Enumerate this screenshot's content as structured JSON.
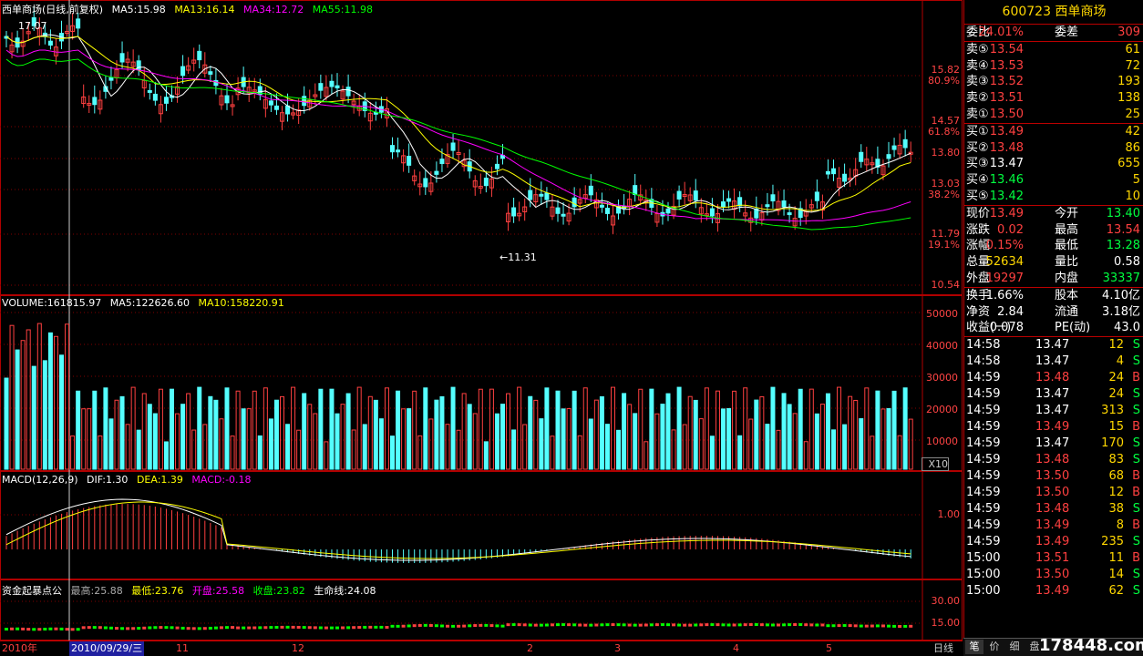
{
  "price_header": {
    "name": "西单商场(日线,前复权)",
    "ma5": "MA5:15.98",
    "ma13": "MA13:16.14",
    "ma34": "MA34:12.72",
    "ma55": "MA55:11.98"
  },
  "price_axis": [
    "15.82",
    "80.9%",
    "14.57",
    "61.8%",
    "13.80",
    "13.03",
    "38.2%",
    "11.79",
    "19.1%",
    "10.54"
  ],
  "price_annotations": {
    "high": "17.07",
    "low": "←11.31"
  },
  "volume_header": {
    "volume": "VOLUME:161815.97",
    "ma5": "MA5:122626.60",
    "ma10": "MA10:158220.91"
  },
  "volume_axis": [
    "50000",
    "40000",
    "30000",
    "20000",
    "10000",
    "X10"
  ],
  "macd_header": {
    "name": "MACD(12,26,9)",
    "dif": "DIF:1.30",
    "dea": "DEA:1.39",
    "macd": "MACD:-0.18"
  },
  "macd_axis": [
    "1.00"
  ],
  "fund_header": {
    "name": "资金起暴点公",
    "high": "最高:25.88",
    "low": "最低:23.76",
    "open": "开盘:25.58",
    "close": "收盘:23.82",
    "life": "生命线:24.08"
  },
  "fund_axis": [
    "30.00",
    "15.00"
  ],
  "date_axis": {
    "year": "2010年",
    "cursor_date": "2010/09/29/三",
    "months": [
      "11",
      "12",
      "2",
      "3",
      "4",
      "5"
    ],
    "period": "日线"
  },
  "quote": {
    "title": "600723 西单商场",
    "ratio": {
      "label": "委比",
      "value": "24.01%",
      "label2": "委差",
      "value2": "309"
    },
    "sells": [
      {
        "label": "卖⑤",
        "price": "13.54",
        "vol": "61"
      },
      {
        "label": "卖④",
        "price": "13.53",
        "vol": "72"
      },
      {
        "label": "卖③",
        "price": "13.52",
        "vol": "193"
      },
      {
        "label": "卖②",
        "price": "13.51",
        "vol": "138"
      },
      {
        "label": "卖①",
        "price": "13.50",
        "vol": "25"
      }
    ],
    "buys": [
      {
        "label": "买①",
        "price": "13.49",
        "vol": "42"
      },
      {
        "label": "买②",
        "price": "13.48",
        "vol": "86"
      },
      {
        "label": "买③",
        "price": "13.47",
        "vol": "655"
      },
      {
        "label": "买④",
        "price": "13.46",
        "vol": "5"
      },
      {
        "label": "买⑤",
        "price": "13.42",
        "vol": "10"
      }
    ],
    "stats": [
      {
        "l1": "现价",
        "v1": "13.49",
        "l2": "今开",
        "v2": "13.40"
      },
      {
        "l1": "涨跌",
        "v1": "0.02",
        "l2": "最高",
        "v2": "13.54"
      },
      {
        "l1": "涨幅",
        "v1": "0.15%",
        "l2": "最低",
        "v2": "13.28"
      },
      {
        "l1": "总量",
        "v1": "52634",
        "l2": "量比",
        "v2": "0.58"
      },
      {
        "l1": "外盘",
        "v1": "19297",
        "l2": "内盘",
        "v2": "33337"
      }
    ],
    "info": [
      {
        "l1": "换手",
        "v1": "1.66%",
        "l2": "股本",
        "v2": "4.10亿"
      },
      {
        "l1": "净资",
        "v1": "2.84",
        "l2": "流通",
        "v2": "3.18亿"
      },
      {
        "l1": "收益(一)",
        "v1": "0.078",
        "l2": "PE(动)",
        "v2": "43.0"
      }
    ],
    "ticks": [
      {
        "t": "14:58",
        "p": "13.47",
        "v": "12",
        "s": "S"
      },
      {
        "t": "14:58",
        "p": "13.47",
        "v": "4",
        "s": "S"
      },
      {
        "t": "14:59",
        "p": "13.48",
        "v": "24",
        "s": "B"
      },
      {
        "t": "14:59",
        "p": "13.47",
        "v": "24",
        "s": "S"
      },
      {
        "t": "14:59",
        "p": "13.47",
        "v": "313",
        "s": "S"
      },
      {
        "t": "14:59",
        "p": "13.49",
        "v": "15",
        "s": "B"
      },
      {
        "t": "14:59",
        "p": "13.47",
        "v": "170",
        "s": "S"
      },
      {
        "t": "14:59",
        "p": "13.48",
        "v": "83",
        "s": "S"
      },
      {
        "t": "14:59",
        "p": "13.50",
        "v": "68",
        "s": "B"
      },
      {
        "t": "14:59",
        "p": "13.50",
        "v": "12",
        "s": "B"
      },
      {
        "t": "14:59",
        "p": "13.48",
        "v": "38",
        "s": "S"
      },
      {
        "t": "14:59",
        "p": "13.49",
        "v": "8",
        "s": "B"
      },
      {
        "t": "14:59",
        "p": "13.49",
        "v": "235",
        "s": "S"
      },
      {
        "t": "15:00",
        "p": "13.51",
        "v": "11",
        "s": "B"
      },
      {
        "t": "15:00",
        "p": "13.50",
        "v": "14",
        "s": "S"
      },
      {
        "t": "15:00",
        "p": "13.49",
        "v": "62",
        "s": "S"
      }
    ]
  },
  "right_tabs": [
    "笔",
    "价",
    "细",
    "盘"
  ],
  "watermark": "178448.com",
  "colors": {
    "up": "#ff4040",
    "down": "#54ffff",
    "ma5": "#ffffff",
    "ma13": "#ffff00",
    "ma34": "#ff00ff",
    "ma55": "#00ff00",
    "border": "#b00000"
  }
}
